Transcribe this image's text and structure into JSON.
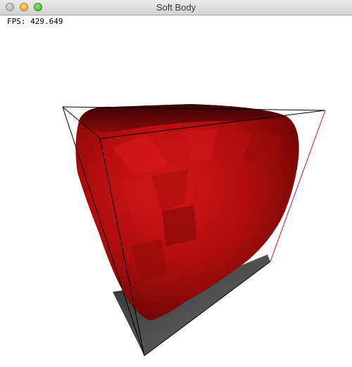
{
  "window": {
    "title": "Soft Body"
  },
  "overlay": {
    "fps_label": "FPS: 429.649"
  },
  "scene": {
    "body_color": "#b50f0f",
    "shadow_color": "#4a4a4a",
    "cage_edge_color": "#000000",
    "cage_accent_color": "#c8102e"
  }
}
